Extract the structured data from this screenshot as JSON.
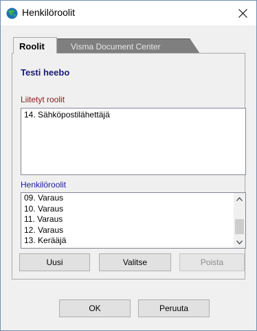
{
  "window": {
    "title": "Henkilöroolit",
    "icon": "app-globe-icon",
    "close_icon": "close-icon"
  },
  "tabs": [
    {
      "label": "Roolit",
      "active": true
    },
    {
      "label": "Visma Document Center",
      "active": false
    }
  ],
  "person": {
    "name": "Testi heebo"
  },
  "attached_roles": {
    "label": "Liitetyt roolit",
    "items": [
      "14. Sähköpostilähettäjä"
    ]
  },
  "person_roles": {
    "label": "Henkilöroolit",
    "items": [
      "09. Varaus",
      "10. Varaus",
      "11. Varaus",
      "12. Varaus",
      "13. Kerääjä"
    ]
  },
  "actions": {
    "new_label": "Uusi",
    "select_label": "Valitse",
    "delete_label": "Poista"
  },
  "footer": {
    "ok_label": "OK",
    "cancel_label": "Peruuta"
  },
  "colors": {
    "attached_label": "#8b1a1a",
    "roles_label": "#1a1a9e",
    "name": "#1a1a7e"
  }
}
